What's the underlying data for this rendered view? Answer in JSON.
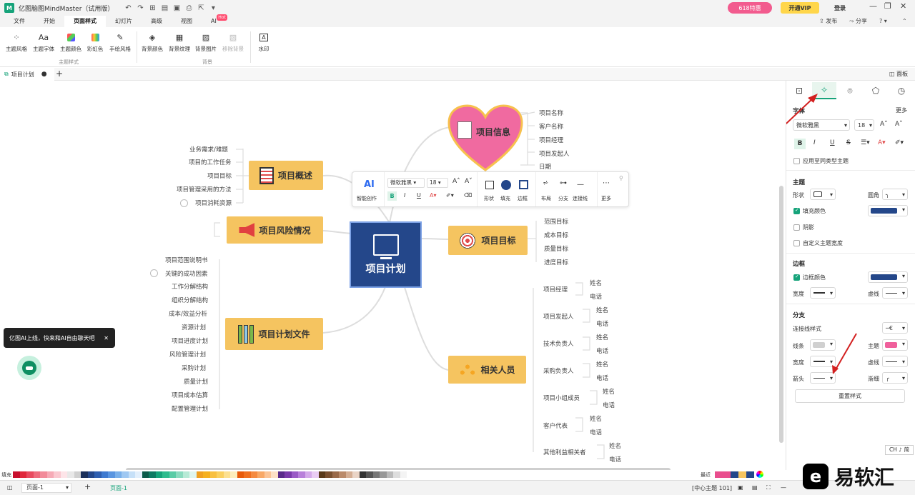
{
  "titlebar": {
    "logo": "M",
    "title": "亿图脑图MindMaster（试用版）",
    "qa_icons": [
      "undo-icon",
      "redo-icon",
      "new-icon",
      "open-icon",
      "save-icon",
      "print-icon",
      "export-icon",
      "more-icon"
    ],
    "badge": "618特惠",
    "vip": "开通VIP",
    "login": "登录"
  },
  "menu": {
    "items": [
      "文件",
      "开始",
      "页面样式",
      "幻灯片",
      "高级",
      "视图",
      "AI"
    ],
    "active": "页面样式",
    "hot": "Hot",
    "publish": "发布",
    "share": "分享",
    "help": "?"
  },
  "ribbon": {
    "group1": {
      "buttons": [
        "主题风格",
        "主题字体",
        "主题颜色",
        "彩虹色",
        "手绘风格"
      ],
      "label": "主题样式"
    },
    "group2": {
      "buttons": [
        "背景颜色",
        "背景纹理",
        "背景图片",
        "移除背景"
      ],
      "label": "背景"
    },
    "group3": {
      "buttons": [
        "水印"
      ]
    }
  },
  "tabs": {
    "doc": "项目计划",
    "panel_toggle": "面板"
  },
  "mindmap": {
    "center": "项目计划",
    "topics": {
      "info": "项目信息",
      "overview": "项目概述",
      "risk": "项目风险情况",
      "docs": "项目计划文件",
      "goal": "项目目标",
      "people": "相关人员"
    },
    "info_leaves": [
      "项目名称",
      "客户名称",
      "项目经理",
      "项目发起人",
      "日期"
    ],
    "overview_leaves": [
      "业务需求/难题",
      "项目的工作任务",
      "项目目标",
      "项目管理采用的方法",
      "项目消耗资源"
    ],
    "docs_leaves": [
      "项目范围说明书",
      "关键的成功因素",
      "工作分解结构",
      "组织分解结构",
      "成本/效益分析",
      "资源计划",
      "项目进度计划",
      "风险管理计划",
      "采购计划",
      "质量计划",
      "项目成本估算",
      "配置管理计划"
    ],
    "goal_leaves": [
      "范围目标",
      "成本目标",
      "质量目标",
      "进度目标"
    ],
    "people_roles": [
      "项目经理",
      "项目发起人",
      "技术负责人",
      "采购负责人",
      "项目小组成员",
      "客户代表",
      "其他利益相关者"
    ],
    "name_label": "姓名",
    "phone_label": "电话"
  },
  "floating_toolbar": {
    "ai": "AI",
    "ai_label": "智能创作",
    "font": "微软雅黑",
    "size": "18",
    "bold": "B",
    "italic": "I",
    "underline": "U",
    "shape": "形状",
    "fill": "填充",
    "border": "边框",
    "layout": "布局",
    "branch": "分支",
    "connector": "连接线",
    "more": "更多"
  },
  "ai_tip": {
    "text": "亿图AI上线，快来和AI自由聊天吧",
    "close": "✕"
  },
  "panel": {
    "font_title": "字体",
    "more": "更多",
    "font": "微软雅黑",
    "size": "18",
    "apply_same": "应用至同类型主题",
    "topic_title": "主题",
    "shape_label": "形状",
    "corner_label": "圆角",
    "fill_label": "填充颜色",
    "shadow_label": "阴影",
    "custom_width_label": "自定义主题宽度",
    "border_title": "边框",
    "border_color_label": "边框颜色",
    "width_label": "宽度",
    "dash_label": "虚线",
    "branch_title": "分支",
    "connector_style_label": "连接线样式",
    "line_label": "线条",
    "topic_color_label": "主题",
    "arrow_label": "箭头",
    "taper_label": "渐细",
    "reset": "重置样式",
    "fill_color": "#24478a",
    "border_color": "#24478a",
    "topic_color": "#f0609c",
    "line_color": "#d0d0d0"
  },
  "palette": {
    "fill_label": "填充",
    "recent_label": "最近"
  },
  "status": {
    "page": "页面-1",
    "page_tab": "页面-1",
    "info": "[中心主题 101]",
    "ime": "CH ♪ 简"
  },
  "watermark": {
    "text": "易软汇"
  }
}
